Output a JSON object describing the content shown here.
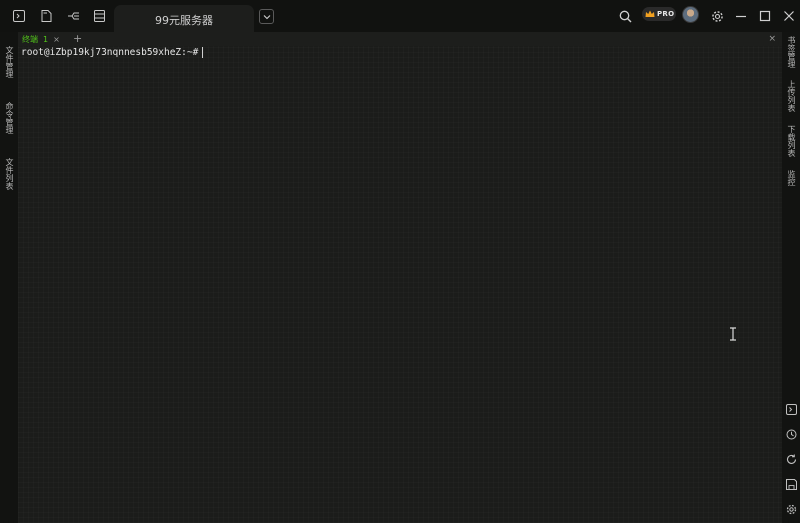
{
  "titlebar": {
    "tab_title": "99元服务器",
    "pro_label": "PRO"
  },
  "subtabs": {
    "terminal_label": "终端",
    "terminal_number": "1",
    "close_symbol": "×",
    "add_symbol": "+",
    "panel_close_symbol": "×"
  },
  "left_rail": {
    "items": [
      "文件管理",
      "命令管理",
      "文件列表"
    ]
  },
  "right_rail": {
    "items": [
      "书签管理",
      "上传列表",
      "下载列表",
      "监控"
    ]
  },
  "terminal": {
    "prompt": "root@iZbp19kj73nqnnesb59xheZ:~#"
  },
  "icons": {
    "titlebar_left": [
      "terminal-icon",
      "file-icon",
      "branch-icon",
      "list-icon"
    ],
    "titlebar_right": [
      "search-icon",
      "settings-icon",
      "minimize-icon",
      "maximize-icon",
      "close-icon"
    ],
    "right_rail_bottom": [
      "terminal-icon",
      "history-icon",
      "refresh-icon",
      "save-icon",
      "settings-icon"
    ]
  },
  "colors": {
    "accent_green": "#52c41a",
    "background": "#1b1c1a",
    "titlebar": "#111210"
  }
}
